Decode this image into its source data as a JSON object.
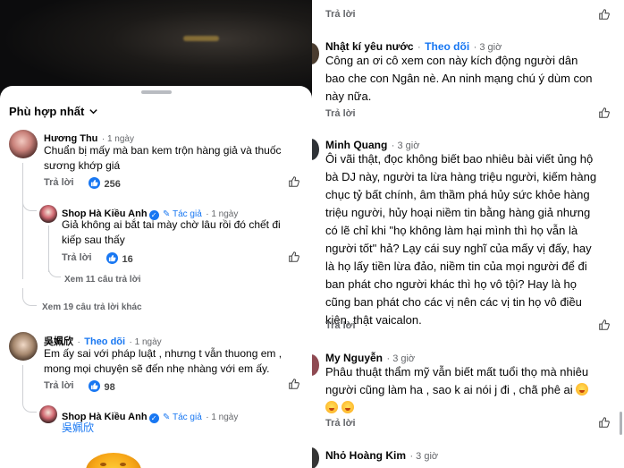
{
  "left": {
    "sort_label": "Phù hợp nhất",
    "comments": [
      {
        "name": "Hương Thu",
        "time": "· 1 ngày",
        "text_lines": [
          "Chuẩn bị mấy mà ban kem trộn hàng giả và thuốc",
          "sương khớp giá"
        ],
        "reply_label": "Trả lời",
        "likes": "256"
      },
      {
        "name": "Shop Hà Kiều Anh",
        "author_tag": "Tác giả",
        "time": "· 1 ngày",
        "text_lines": [
          "Giả không ai bắt tai mày chờ lâu rồi đó chết đi",
          "kiếp sau thấy"
        ],
        "reply_label": "Trả lời",
        "likes": "16",
        "see_replies": "Xem 11 câu trả lời"
      },
      {
        "see_more_replies": "Xem 19 câu trả lời khác"
      },
      {
        "name": "吳姵欣",
        "follow_label": "Theo dõi",
        "time": "· 1 ngày",
        "text_lines": [
          "Em ấy sai với pháp luật , nhưng t vẫn thuong em ,",
          "mong mọi chuyện sẽ đến nhẹ nhàng với em ấy."
        ],
        "reply_label": "Trả lời",
        "likes": "98"
      },
      {
        "name": "Shop Hà Kiều Anh",
        "author_tag": "Tác giả",
        "time": "· 1 ngày",
        "mention": "吳姵欣"
      }
    ]
  },
  "right": {
    "top_reply_label": "Trả lời",
    "comments": [
      {
        "name": "Nhật kí yêu nước",
        "follow_label": "Theo dõi",
        "time": "· 3 giờ",
        "text_lines": [
          "Công an ơi cô xem con này kích động người dân",
          "bao che con Ngân nè. An ninh mạng chú ý dùm con",
          "này nữa."
        ],
        "reply_label": "Trả lời"
      },
      {
        "name": "Minh Quang",
        "time": "· 3 giờ",
        "text_lines": [
          "Ôi vãi thật, đọc không biết bao nhiêu bài viết ủng hộ",
          "bà DJ này, người ta lừa hàng triệu người, kiếm hàng",
          "chục tỷ bất chính, âm thầm phá hủy sức khỏe hàng",
          "triệu người, hủy hoại niềm tin bằng hàng giả nhưng",
          "có lẽ chỉ khi \"họ không làm hại mình thì họ vẫn là",
          "người tốt\" hả? Lạy cái suy nghĩ của mấy vị đấy, hay",
          "là họ lấy tiền lừa đảo, niềm tin của mọi người để đi",
          "ban phát cho người khác thì họ vô tội? Hay là họ",
          "cũng ban phát cho các vị nên các vị tin họ vô điều",
          "kiện, thật vaicalon."
        ],
        "reply_label": "Trả lời"
      },
      {
        "name": "My Nguyễn",
        "time": "· 3 giờ",
        "text_lines": [
          "Phâu thuật thẩm mỹ vẫn biết mất tuổi thọ mà nhiêu",
          "người cũng làm ha , sao k ai nói j đi , chã phê ai"
        ],
        "reply_label": "Trả lời"
      },
      {
        "name": "Nhỏ Hoàng Kim",
        "time": "· 3 giờ"
      }
    ]
  },
  "colors": {
    "accent": "#1877f2",
    "muted_text": "#65676b",
    "video_bg": "#0b0b0d"
  }
}
